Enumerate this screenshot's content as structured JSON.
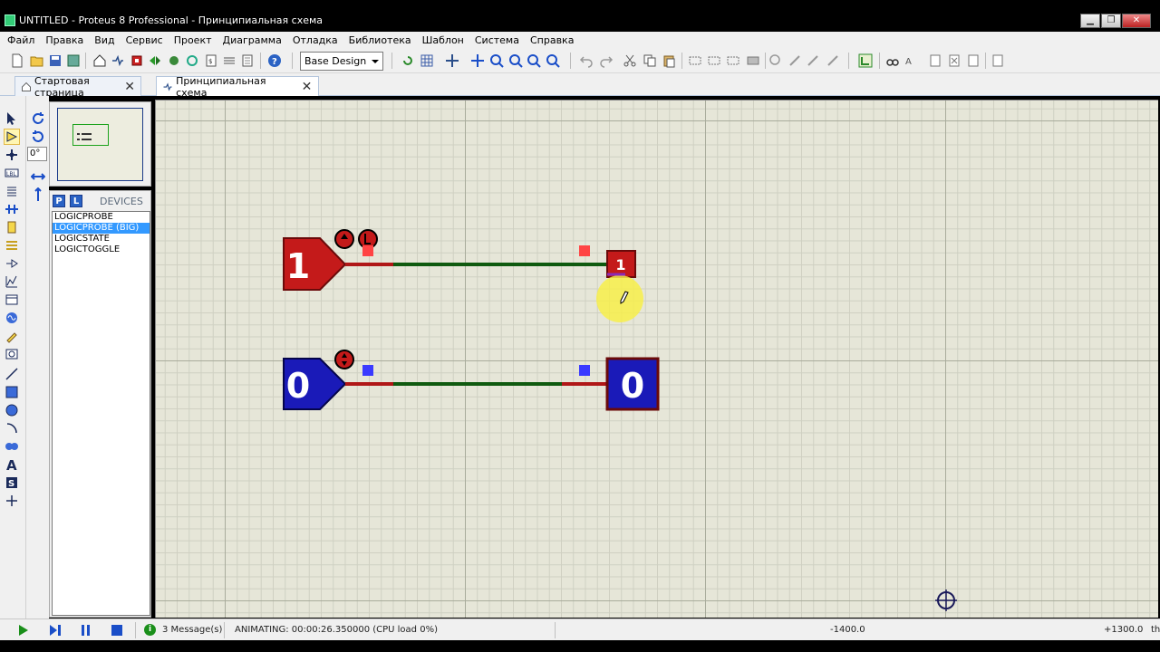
{
  "window": {
    "title": "UNTITLED - Proteus 8 Professional - Принципиальная схема",
    "minimize": "▁",
    "maximize": "❐",
    "close": "✕"
  },
  "menu": [
    "Файл",
    "Правка",
    "Вид",
    "Сервис",
    "Проект",
    "Диаграмма",
    "Отладка",
    "Библиотека",
    "Шаблон",
    "Система",
    "Справка"
  ],
  "toolbar": {
    "design_variant": "Base Design"
  },
  "tabs": [
    {
      "label": "Стартовая страница",
      "icon": "home-icon",
      "active": false
    },
    {
      "label": "Принципиальная схема",
      "icon": "schematic-icon",
      "active": true
    }
  ],
  "rotation": {
    "angle": "0°"
  },
  "devices": {
    "title": "DEVICES",
    "p_button": "P",
    "l_button": "L",
    "items": [
      "LOGICPROBE",
      "LOGICPROBE (BIG)",
      "LOGICSTATE",
      "LOGICTOGGLE"
    ],
    "selected": "LOGICPROBE (BIG)"
  },
  "schematic": {
    "state_high": "1",
    "state_low": "0",
    "probe_small": "1",
    "probe_big": "0",
    "colors": {
      "high": "#c41a1a",
      "low": "#1a1ab8",
      "wire_mid": "#0f5a0f",
      "wire_end_high": "#b01717",
      "pin_marker_high": "#ff4444",
      "pin_marker_low": "#3a3aff"
    }
  },
  "status": {
    "message_count": "3 Message(s)",
    "animating": "ANIMATING: 00:00:26.350000 (CPU load 0%)",
    "coord_x": "-1400.0",
    "coord_y": "+1300.0",
    "unit": "th"
  }
}
